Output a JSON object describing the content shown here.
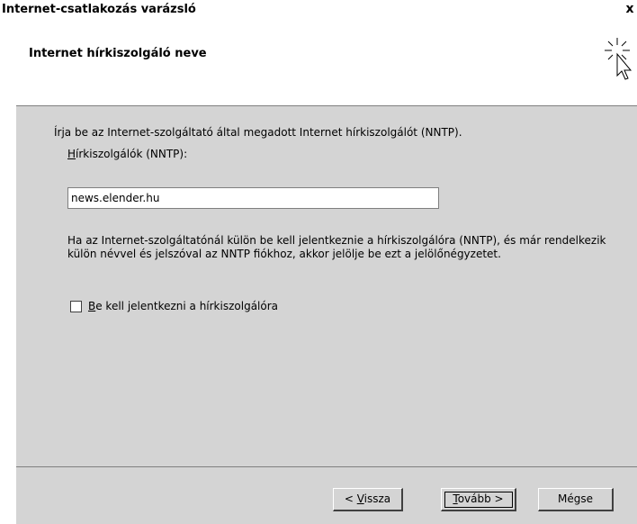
{
  "window": {
    "title": "Internet-csatlakozás varázsló",
    "close_label": "x"
  },
  "header": {
    "title": "Internet hírkiszolgáló neve",
    "icon": "wizard-cursor-icon"
  },
  "body": {
    "instruction": "Írja be az Internet-szolgáltató által megadott Internet hírkiszolgálót (NNTP).",
    "field_label_access": "H",
    "field_label_rest": "írkiszolgálók (NNTP):",
    "news_server_value": "news.elender.hu",
    "paragraph": "Ha az Internet-szolgáltatónál külön be kell jelentkeznie a hírkiszolgálóra (NNTP), és már rendelkezik külön névvel és jelszóval az NNTP fiókhoz, akkor jelölje be ezt a jelölőnégyzetet.",
    "checkbox_label_access": "B",
    "checkbox_label_rest": "e kell jelentkezni a hírkiszolgálóra",
    "checkbox_checked": false
  },
  "footer": {
    "back_prefix": "< ",
    "back_access": "V",
    "back_rest": "issza",
    "next_access": "T",
    "next_rest": "ovább >",
    "cancel_label": "Mégse"
  }
}
